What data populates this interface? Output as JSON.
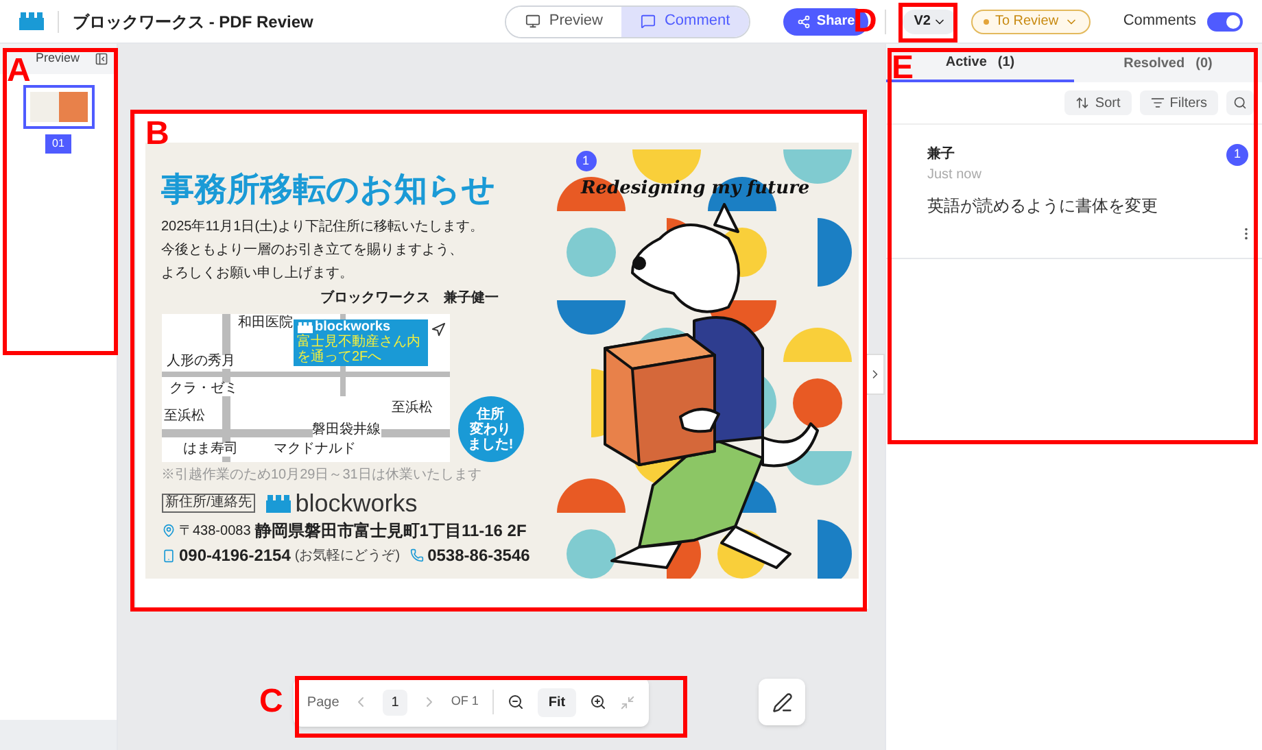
{
  "app": {
    "title": "ブロックワークス - PDF Review"
  },
  "view_tabs": [
    {
      "label": "Preview",
      "selected": false
    },
    {
      "label": "Comment",
      "selected": true
    }
  ],
  "share_button": "Share",
  "version": "V2",
  "status": "To Review",
  "comments_toggle": {
    "label": "Comments",
    "on": true
  },
  "sidebar": {
    "title": "Preview",
    "pages": [
      {
        "label": "01",
        "selected": true
      }
    ]
  },
  "document": {
    "title": "事務所移転のお知らせ",
    "body": [
      "2025年11月1日(土)より下記住所に移転いたします。",
      "今後ともより一層のお引き立てを賜りますよう、",
      "よろしくお願い申し上げます。"
    ],
    "signature": "ブロックワークス　兼子健一",
    "map_labels": [
      "和田医院",
      "人形の秀月",
      "クラ・ゼミ",
      "至浜松",
      "至浜松",
      "はま寿司",
      "マクドナルド",
      "磐田袋井線"
    ],
    "map_brand": "blockworks",
    "map_note": "富士見不動産さん内を通って2Fへ",
    "notice": "※引越作業のため10月29日～31日は休業いたします",
    "bubble_lines": [
      "住所",
      "変わり",
      "ました!"
    ],
    "tag": "新住所/連絡先",
    "brand": "blockworks",
    "postal": "〒438-0083",
    "address": "静岡県磐田市富士見町1丁目11-16 2F",
    "mobile": "090-4196-2154",
    "mobile_note": "(お気軽にどうぞ)",
    "phone": "0538-86-3546",
    "tagline": "Redesigning my future",
    "pin": "1"
  },
  "pager": {
    "label": "Page",
    "page": "1",
    "of": "OF 1",
    "fit": "Fit"
  },
  "comments": {
    "tabs": [
      {
        "label": "Active",
        "count": "(1)",
        "selected": true
      },
      {
        "label": "Resolved",
        "count": "(0)",
        "selected": false
      }
    ],
    "sort": "Sort",
    "filters": "Filters",
    "items": [
      {
        "author": "兼子",
        "time": "Just now",
        "text": "英語が読めるように書体を変更",
        "pin": "1"
      }
    ]
  },
  "annotations": [
    {
      "label": "A"
    },
    {
      "label": "B"
    },
    {
      "label": "C"
    },
    {
      "label": "D"
    },
    {
      "label": "E"
    }
  ]
}
